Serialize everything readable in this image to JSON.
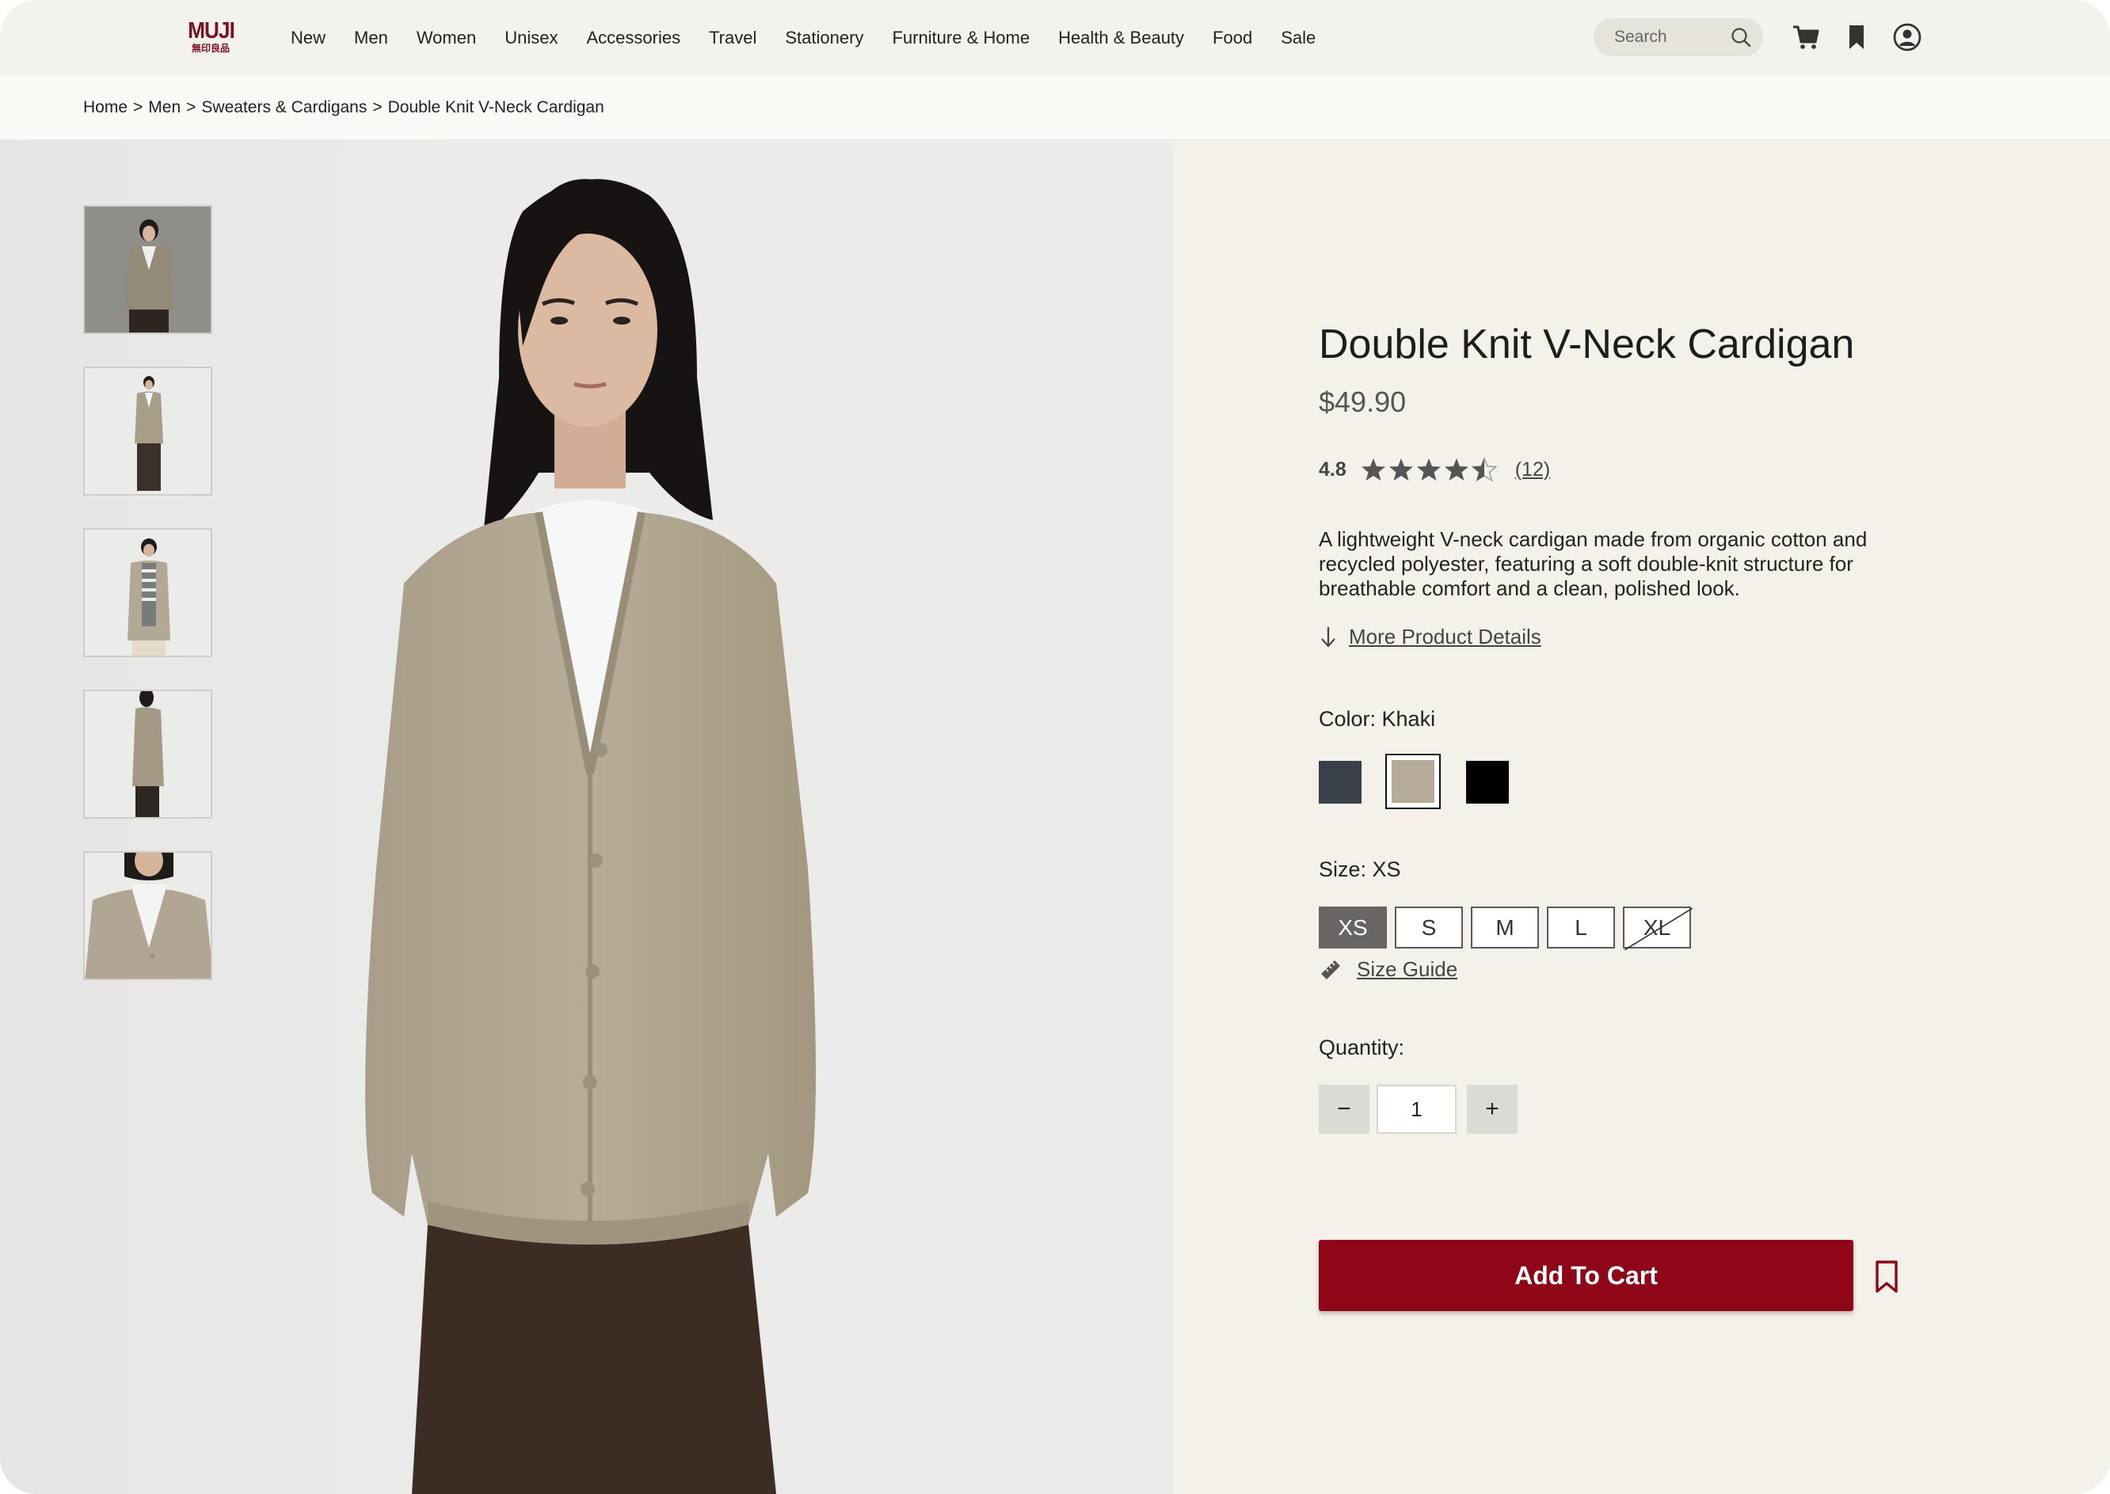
{
  "header": {
    "logo": {
      "brand": "MUJI",
      "sub": "無印良品"
    },
    "nav": [
      "New",
      "Men",
      "Women",
      "Unisex",
      "Accessories",
      "Travel",
      "Stationery",
      "Furniture & Home",
      "Health & Beauty",
      "Food",
      "Sale"
    ],
    "search_placeholder": "Search",
    "icons": [
      "search-icon",
      "cart-icon",
      "bookmark-icon",
      "account-icon"
    ]
  },
  "breadcrumb": [
    "Home",
    "Men",
    "Sweaters & Cardigans",
    "Double Knit V-Neck Cardigan"
  ],
  "breadcrumb_sep": ">",
  "product": {
    "title": "Double Knit V-Neck Cardigan",
    "price": "$49.90",
    "rating": "4.8",
    "rating_value": 4.8,
    "review_count": "(12)",
    "description": "A lightweight V-neck cardigan made from organic cotton and recycled polyester, featuring a soft double-knit structure for breathable comfort and a clean, polished look.",
    "more_details": "More Product Details",
    "color_label": "Color: Khaki",
    "colors": [
      {
        "name": "navy",
        "hex": "#3a414b",
        "selected": false
      },
      {
        "name": "khaki",
        "hex": "#b6aa99",
        "selected": true
      },
      {
        "name": "black",
        "hex": "#000000",
        "selected": false
      }
    ],
    "size_label": "Size: XS",
    "sizes": [
      {
        "label": "XS",
        "selected": true,
        "available": true
      },
      {
        "label": "S",
        "selected": false,
        "available": true
      },
      {
        "label": "M",
        "selected": false,
        "available": true
      },
      {
        "label": "L",
        "selected": false,
        "available": true
      },
      {
        "label": "XL",
        "selected": false,
        "available": false
      }
    ],
    "size_guide": "Size Guide",
    "quantity_label": "Quantity:",
    "quantity": "1",
    "decrement": "−",
    "increment": "+",
    "add_to_cart": "Add To Cart"
  },
  "gallery": {
    "thumbnails": [
      "cardigan-front-dark-bg",
      "cardigan-full-length",
      "cardigan-women-striped-shirt",
      "cardigan-side-view",
      "cardigan-closeup"
    ],
    "active_thumbnail": 0
  },
  "colors": {
    "brand_red": "#8e0618",
    "panel_bg": "#f4f1ea",
    "header_bg": "#f4f2ec"
  }
}
